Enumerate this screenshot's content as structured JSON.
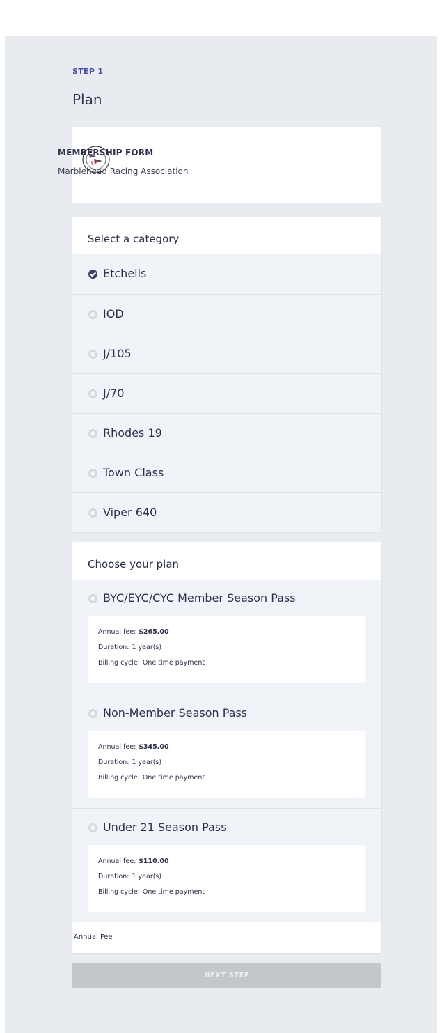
{
  "step": {
    "label": "STEP 1",
    "title": "Plan"
  },
  "form": {
    "title": "MEMBERSHIP FORM",
    "organization": "Marblehead Racing Association",
    "logo_icon": "club-burgee-logo"
  },
  "category_section": {
    "heading": "Select a category",
    "selected": "Etchells",
    "items": [
      {
        "label": "Etchells",
        "checked": true
      },
      {
        "label": "IOD",
        "checked": false
      },
      {
        "label": "J/105",
        "checked": false
      },
      {
        "label": "J/70",
        "checked": false
      },
      {
        "label": "Rhodes 19",
        "checked": false
      },
      {
        "label": "Town Class",
        "checked": false
      },
      {
        "label": "Viper 640",
        "checked": false
      }
    ]
  },
  "plan_section": {
    "heading": "Choose your plan",
    "field_labels": {
      "annual_fee": "Annual fee:",
      "duration": "Duration:",
      "billing_cycle": "Billing cycle:"
    },
    "plans": [
      {
        "label": "BYC/EYC/CYC Member Season Pass",
        "annual_fee": "$265.00",
        "duration": "1 year(s)",
        "billing_cycle": "One time payment"
      },
      {
        "label": "Non-Member Season Pass",
        "annual_fee": "$345.00",
        "duration": "1 year(s)",
        "billing_cycle": "One time payment"
      },
      {
        "label": "Under 21 Season Pass",
        "annual_fee": "$110.00",
        "duration": "1 year(s)",
        "billing_cycle": "One time payment"
      }
    ],
    "footer_label": "Annual Fee"
  },
  "actions": {
    "next_label": "NEXT STEP"
  },
  "colors": {
    "accent": "#4a50a8",
    "text": "#2b2f4a",
    "page_background": "#e8ecf1",
    "row_background": "#f0f3f8",
    "disabled_button": "#c4c7ca",
    "checked_radio": "#3d4267"
  }
}
